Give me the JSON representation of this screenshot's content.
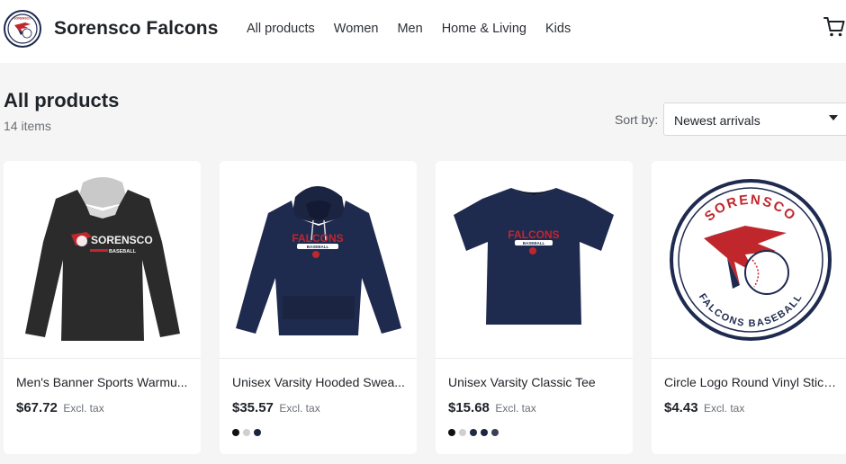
{
  "brand": {
    "name": "Sorensco Falcons",
    "logo_text": "SORENSCO"
  },
  "nav": [
    {
      "label": "All products"
    },
    {
      "label": "Women"
    },
    {
      "label": "Men"
    },
    {
      "label": "Home & Living"
    },
    {
      "label": "Kids"
    }
  ],
  "page": {
    "title": "All products",
    "count": "14 items"
  },
  "sort": {
    "label": "Sort by:",
    "value": "Newest arrivals"
  },
  "products": [
    {
      "name": "Men's Banner Sports Warmu...",
      "price": "$67.72",
      "tax": "Excl. tax",
      "image_text": [
        "SORENSCO",
        "BASEBALL"
      ],
      "swatches": []
    },
    {
      "name": "Unisex Varsity Hooded Swea...",
      "price": "$35.57",
      "tax": "Excl. tax",
      "image_text": [
        "FALCONS",
        "BASEBALL"
      ],
      "swatches": [
        "#111111",
        "#cfcfcf",
        "#1b2440"
      ]
    },
    {
      "name": "Unisex Varsity Classic Tee",
      "price": "$15.68",
      "tax": "Excl. tax",
      "image_text": [
        "FALCONS",
        "BASEBALL"
      ],
      "swatches": [
        "#111111",
        "#cfcfcf",
        "#1f2a44",
        "#1b2440",
        "#3a3f55"
      ]
    },
    {
      "name": "Circle Logo Round Vinyl Stick...",
      "price": "$4.43",
      "tax": "Excl. tax",
      "image_text": [
        "SORENSCO",
        "FALCONS BASEBALL"
      ],
      "swatches": []
    }
  ],
  "colors": {
    "navy": "#1e2a4f",
    "red": "#c0272d",
    "page_bg": "#f5f5f5"
  },
  "icons": {
    "cart": "cart-icon",
    "caret": "chevron-down-icon"
  }
}
